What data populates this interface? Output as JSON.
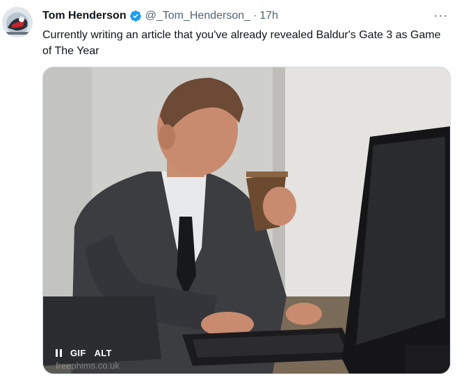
{
  "tweet": {
    "author_name": "Tom Henderson",
    "handle": "@_Tom_Henderson_",
    "separator": "·",
    "time": "17h",
    "more_label": "···",
    "text": "Currently writing an article that you've already revealed Baldur's Gate 3 as Game of The Year"
  },
  "media": {
    "gif_badge": "GIF",
    "alt_badge": "ALT",
    "watermark": "freephims.co.uk"
  },
  "colors": {
    "verified": "#1d9bf0",
    "secondary_text": "#536471",
    "primary_text": "#0f1419"
  },
  "icons": [
    "avatar-image",
    "verified-badge-icon",
    "more-options-icon",
    "pause-icon"
  ]
}
